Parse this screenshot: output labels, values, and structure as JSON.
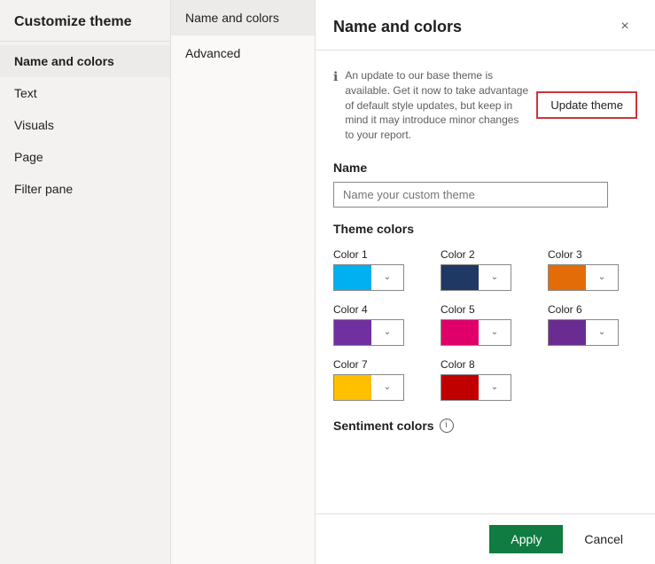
{
  "sidebar": {
    "header": "Customize theme",
    "items": [
      {
        "id": "name-and-colors",
        "label": "Name and colors",
        "active": true
      },
      {
        "id": "text",
        "label": "Text",
        "active": false
      },
      {
        "id": "visuals",
        "label": "Visuals",
        "active": false
      },
      {
        "id": "page",
        "label": "Page",
        "active": false
      },
      {
        "id": "filter-pane",
        "label": "Filter pane",
        "active": false
      }
    ]
  },
  "middle": {
    "items": [
      {
        "id": "name-and-colors",
        "label": "Name and colors",
        "active": true
      },
      {
        "id": "advanced",
        "label": "Advanced",
        "active": false
      }
    ]
  },
  "main": {
    "title": "Name and colors",
    "close_label": "×",
    "info_text": "An update to our base theme is available. Get it now to take advantage of default style updates, but keep in mind it may introduce minor changes to your report.",
    "update_theme_label": "Update theme",
    "name_section_label": "Name",
    "name_placeholder": "Name your custom theme",
    "theme_colors_title": "Theme colors",
    "colors": [
      {
        "id": "color1",
        "label": "Color 1",
        "hex": "#00B0F0"
      },
      {
        "id": "color2",
        "label": "Color 2",
        "hex": "#1F3864"
      },
      {
        "id": "color3",
        "label": "Color 3",
        "hex": "#E36C09"
      },
      {
        "id": "color4",
        "label": "Color 4",
        "hex": "#7030A0"
      },
      {
        "id": "color5",
        "label": "Color 5",
        "hex": "#E0006A"
      },
      {
        "id": "color6",
        "label": "Color 6",
        "hex": "#6A2C91"
      },
      {
        "id": "color7",
        "label": "Color 7",
        "hex": "#FFC000"
      },
      {
        "id": "color8",
        "label": "Color 8",
        "hex": "#C00000"
      }
    ],
    "sentiment_title": "Sentiment colors",
    "footer": {
      "apply_label": "Apply",
      "cancel_label": "Cancel"
    }
  }
}
